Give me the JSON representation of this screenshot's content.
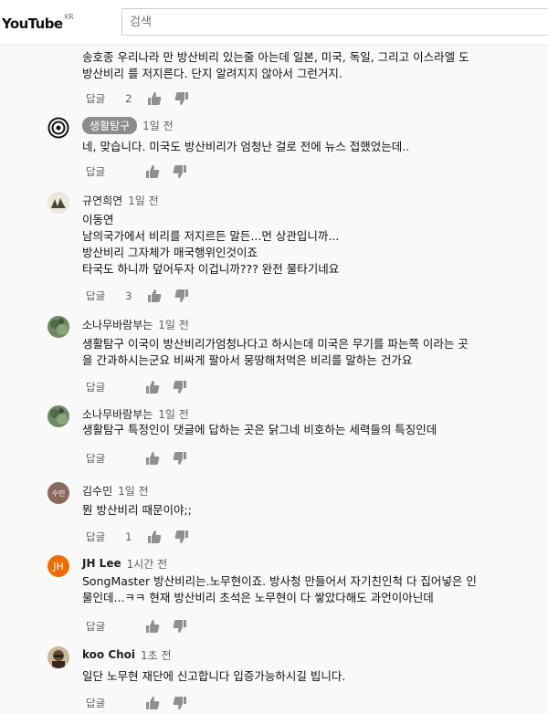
{
  "header": {
    "logo_text": "YouTube",
    "region": "KR",
    "search_placeholder": "검색"
  },
  "comments": [
    {
      "author": "",
      "time": "",
      "lines": [
        "송호종 우리나라 만 방산비리 있는줄 아는데 일본, 미국, 독일, 그리고 이스라엘 도",
        "방산비리 를 저지른다. 단지 알려지지 않아서 그런거지."
      ],
      "reply_label": "답글",
      "likes": "2"
    },
    {
      "author": "생활탐구",
      "time": "1일 전",
      "lines": [
        "네, 맞습니다. 미국도 방산비리가 엄청난 걸로 전에 뉴스 접했었는데.."
      ],
      "reply_label": "답글",
      "likes": ""
    },
    {
      "author": "규연희연",
      "time": "1일 전",
      "lines": [
        "이동연",
        "남의국가에서 비리를 저지르든 말든...먼 상관입니까...",
        "방산비리 그자체가 매국행위인것이죠",
        "타국도 하니까 덮어두자  이겁니까???  완전 물타기네요"
      ],
      "reply_label": "답글",
      "likes": "3"
    },
    {
      "author": "소나무바람부는",
      "time": "1일 전",
      "lines": [
        "생활탐구 이국이 방산비리가엄청나다고 하시는데 미국은 무기를 파는쪽 이라는 곳",
        "을 간과하시는군요 비싸게 팔아서 뭉땅해처먹은 비리를 말하는 건가요"
      ],
      "reply_label": "답글",
      "likes": ""
    },
    {
      "author": "소나무바람부는",
      "time": "1일 전",
      "lines": [
        "생활탐구 특정인이 댓글에 답하는 곳은  닭그네  비호하는 세력들의 특징인데"
      ],
      "reply_label": "답글",
      "likes": ""
    },
    {
      "author": "김수민",
      "time": "1일 전",
      "avatar_text": "수민",
      "lines": [
        "뭔 방산비리 때문이야;;"
      ],
      "reply_label": "답글",
      "likes": "1"
    },
    {
      "author": "JH Lee",
      "time": "1시간 전",
      "avatar_text": "JH",
      "lines": [
        "SongMaster 방산비리는.노무현이죠. 방사청 만들어서 자기친인척 다 집어넣은 인",
        "물인데...ㅋㅋ 현재 방산비리 초석은 노무현이 다 쌓았다해도 과언이아닌데"
      ],
      "reply_label": "답글",
      "likes": ""
    },
    {
      "author": "koo Choi",
      "time": "1초 전",
      "lines": [
        "일단 노무현 재단에 신고합니다  입증가능하시길 빕니다."
      ],
      "reply_label": "답글",
      "likes": ""
    }
  ],
  "colors": {
    "jh_avatar": "#ef6c00",
    "kim_avatar": "#8a6a5c",
    "chip_bg": "#8c8c8c"
  }
}
